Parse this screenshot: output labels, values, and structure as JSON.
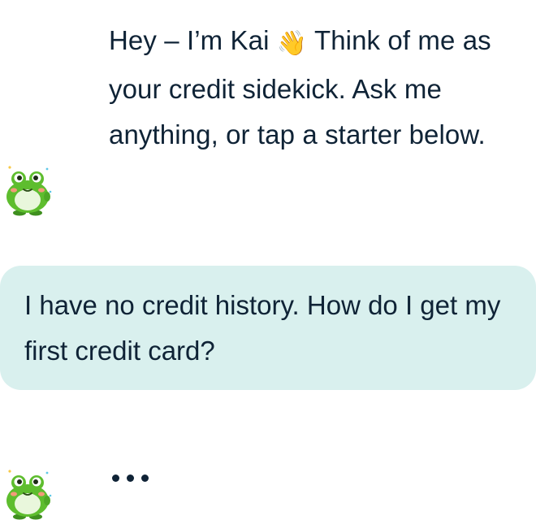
{
  "messages": [
    {
      "role": "assistant",
      "avatar_icon": "frog-mascot-icon",
      "text_before_emoji": "Hey – I’m Kai ",
      "emoji": "👋",
      "text_after_emoji": " Think of me as your credit sidekick. Ask me anything, or tap a starter below."
    },
    {
      "role": "user",
      "text": "I have no credit history. How do I get my first credit card?"
    }
  ],
  "typing_indicator": {
    "avatar_icon": "frog-mascot-icon",
    "label": "•••"
  },
  "colors": {
    "user_bubble_bg": "#d9f0ee",
    "text": "#0f2336",
    "mascot_green": "#5ebd2e"
  }
}
